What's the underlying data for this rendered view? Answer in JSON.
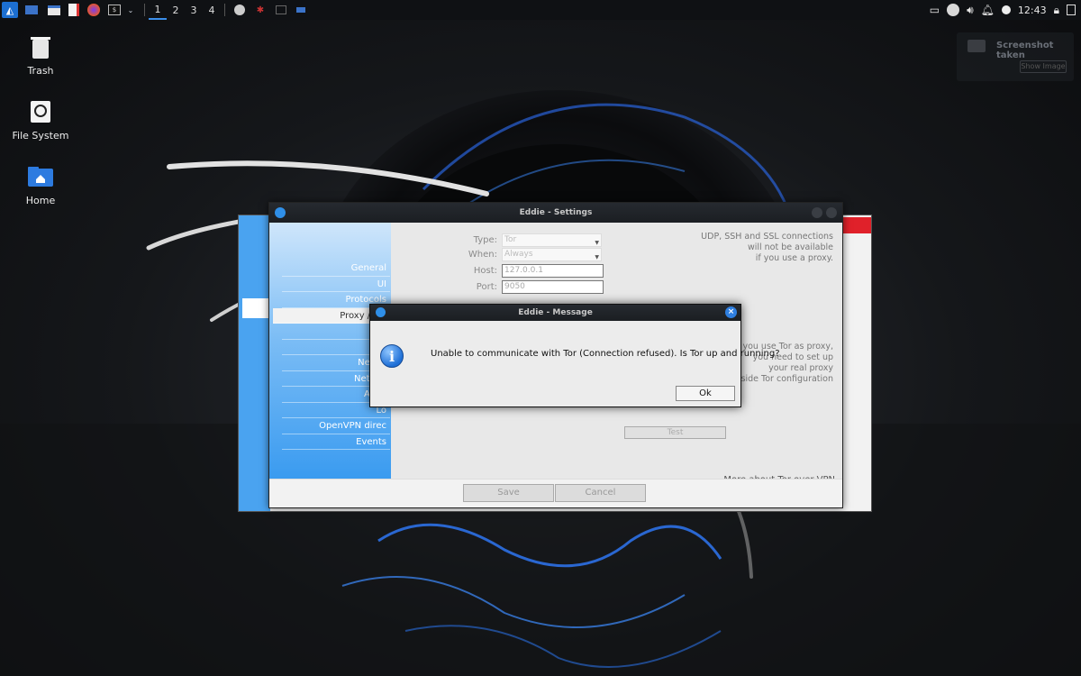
{
  "taskbar": {
    "workspaces": [
      "1",
      "2",
      "3",
      "4"
    ],
    "active_workspace": "1",
    "clock": "12:43"
  },
  "desktop": {
    "icons": [
      {
        "label": "Trash"
      },
      {
        "label": "File System"
      },
      {
        "label": "Home"
      }
    ]
  },
  "notification": {
    "title": "Screenshot taken",
    "button": "Show Image"
  },
  "settings": {
    "title": "Eddie - Settings",
    "menu": [
      "General",
      "UI",
      "Protocols",
      "Proxy / Tor",
      "R",
      "",
      "Netwo",
      "Networ",
      "Adva",
      "Lo",
      "OpenVPN direc",
      "Events"
    ],
    "selected": "Proxy / Tor",
    "fields": {
      "type_label": "Type:",
      "type_value": "Tor",
      "when_label": "When:",
      "when_value": "Always",
      "host_label": "Host:",
      "host_value": "127.0.0.1",
      "port_label": "Port:",
      "port_value": "9050"
    },
    "note_top": [
      "UDP, SSH and SSL connections",
      "will not be available",
      "if you use a proxy."
    ],
    "note_tor": [
      "If you use Tor as proxy,",
      "you need to set up",
      "your real proxy",
      "inside Tor configuration"
    ],
    "test_button": "Test",
    "link": "More about Tor over VPN",
    "save_button": "Save",
    "cancel_button": "Cancel"
  },
  "message": {
    "title": "Eddie - Message",
    "text": "Unable to communicate with Tor (Connection refused). Is Tor up and running?",
    "ok_button": "Ok",
    "close_glyph": "×"
  }
}
